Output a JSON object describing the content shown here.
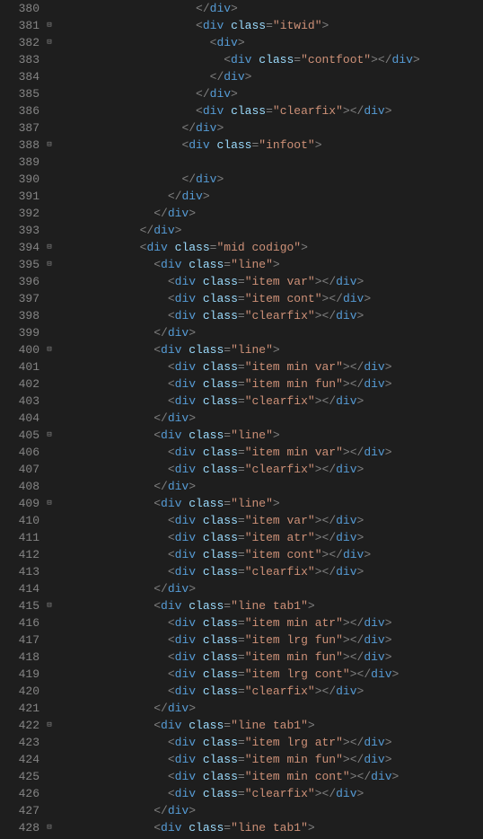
{
  "startLine": 380,
  "lines": [
    {
      "indent": 20,
      "close": "div"
    },
    {
      "fold": true,
      "indent": 20,
      "open": "div",
      "attr": "class",
      "val": "itwid"
    },
    {
      "fold": true,
      "indent": 22,
      "open": "div"
    },
    {
      "indent": 24,
      "open": "div",
      "attr": "class",
      "val": "contfoot",
      "self": true
    },
    {
      "indent": 22,
      "close": "div"
    },
    {
      "indent": 20,
      "close": "div"
    },
    {
      "indent": 20,
      "open": "div",
      "attr": "class",
      "val": "clearfix",
      "self": true
    },
    {
      "indent": 18,
      "close": "div"
    },
    {
      "fold": true,
      "indent": 18,
      "open": "div",
      "attr": "class",
      "val": "infoot"
    },
    {
      "blank": true
    },
    {
      "indent": 18,
      "close": "div"
    },
    {
      "indent": 16,
      "close": "div"
    },
    {
      "indent": 14,
      "close": "div"
    },
    {
      "indent": 12,
      "close": "div"
    },
    {
      "fold": true,
      "indent": 12,
      "open": "div",
      "attr": "class",
      "val": "mid codigo"
    },
    {
      "fold": true,
      "indent": 14,
      "open": "div",
      "attr": "class",
      "val": "line"
    },
    {
      "indent": 16,
      "open": "div",
      "attr": "class",
      "val": "item var",
      "self": true
    },
    {
      "indent": 16,
      "open": "div",
      "attr": "class",
      "val": "item cont",
      "self": true
    },
    {
      "indent": 16,
      "open": "div",
      "attr": "class",
      "val": "clearfix",
      "self": true
    },
    {
      "indent": 14,
      "close": "div"
    },
    {
      "fold": true,
      "indent": 14,
      "open": "div",
      "attr": "class",
      "val": "line"
    },
    {
      "indent": 16,
      "open": "div",
      "attr": "class",
      "val": "item min var",
      "self": true
    },
    {
      "indent": 16,
      "open": "div",
      "attr": "class",
      "val": "item min fun",
      "self": true
    },
    {
      "indent": 16,
      "open": "div",
      "attr": "class",
      "val": "clearfix",
      "self": true
    },
    {
      "indent": 14,
      "close": "div"
    },
    {
      "fold": true,
      "indent": 14,
      "open": "div",
      "attr": "class",
      "val": "line"
    },
    {
      "indent": 16,
      "open": "div",
      "attr": "class",
      "val": "item min var",
      "self": true
    },
    {
      "indent": 16,
      "open": "div",
      "attr": "class",
      "val": "clearfix",
      "self": true
    },
    {
      "indent": 14,
      "close": "div"
    },
    {
      "fold": true,
      "indent": 14,
      "open": "div",
      "attr": "class",
      "val": "line"
    },
    {
      "indent": 16,
      "open": "div",
      "attr": "class",
      "val": "item var",
      "self": true
    },
    {
      "indent": 16,
      "open": "div",
      "attr": "class",
      "val": "item atr",
      "self": true
    },
    {
      "indent": 16,
      "open": "div",
      "attr": "class",
      "val": "item cont",
      "self": true
    },
    {
      "indent": 16,
      "open": "div",
      "attr": "class",
      "val": "clearfix",
      "self": true
    },
    {
      "indent": 14,
      "close": "div"
    },
    {
      "fold": true,
      "indent": 14,
      "open": "div",
      "attr": "class",
      "val": "line tab1"
    },
    {
      "indent": 16,
      "open": "div",
      "attr": "class",
      "val": "item min atr",
      "self": true
    },
    {
      "indent": 16,
      "open": "div",
      "attr": "class",
      "val": "item lrg fun",
      "self": true
    },
    {
      "indent": 16,
      "open": "div",
      "attr": "class",
      "val": "item min fun",
      "self": true
    },
    {
      "indent": 16,
      "open": "div",
      "attr": "class",
      "val": "item lrg cont",
      "self": true
    },
    {
      "indent": 16,
      "open": "div",
      "attr": "class",
      "val": "clearfix",
      "self": true
    },
    {
      "indent": 14,
      "close": "div"
    },
    {
      "fold": true,
      "indent": 14,
      "open": "div",
      "attr": "class",
      "val": "line tab1"
    },
    {
      "indent": 16,
      "open": "div",
      "attr": "class",
      "val": "item lrg atr",
      "self": true
    },
    {
      "indent": 16,
      "open": "div",
      "attr": "class",
      "val": "item min fun",
      "self": true
    },
    {
      "indent": 16,
      "open": "div",
      "attr": "class",
      "val": "item min cont",
      "self": true
    },
    {
      "indent": 16,
      "open": "div",
      "attr": "class",
      "val": "clearfix",
      "self": true
    },
    {
      "indent": 14,
      "close": "div"
    },
    {
      "fold": true,
      "indent": 14,
      "open": "div",
      "attr": "class",
      "val": "line tab1"
    }
  ]
}
